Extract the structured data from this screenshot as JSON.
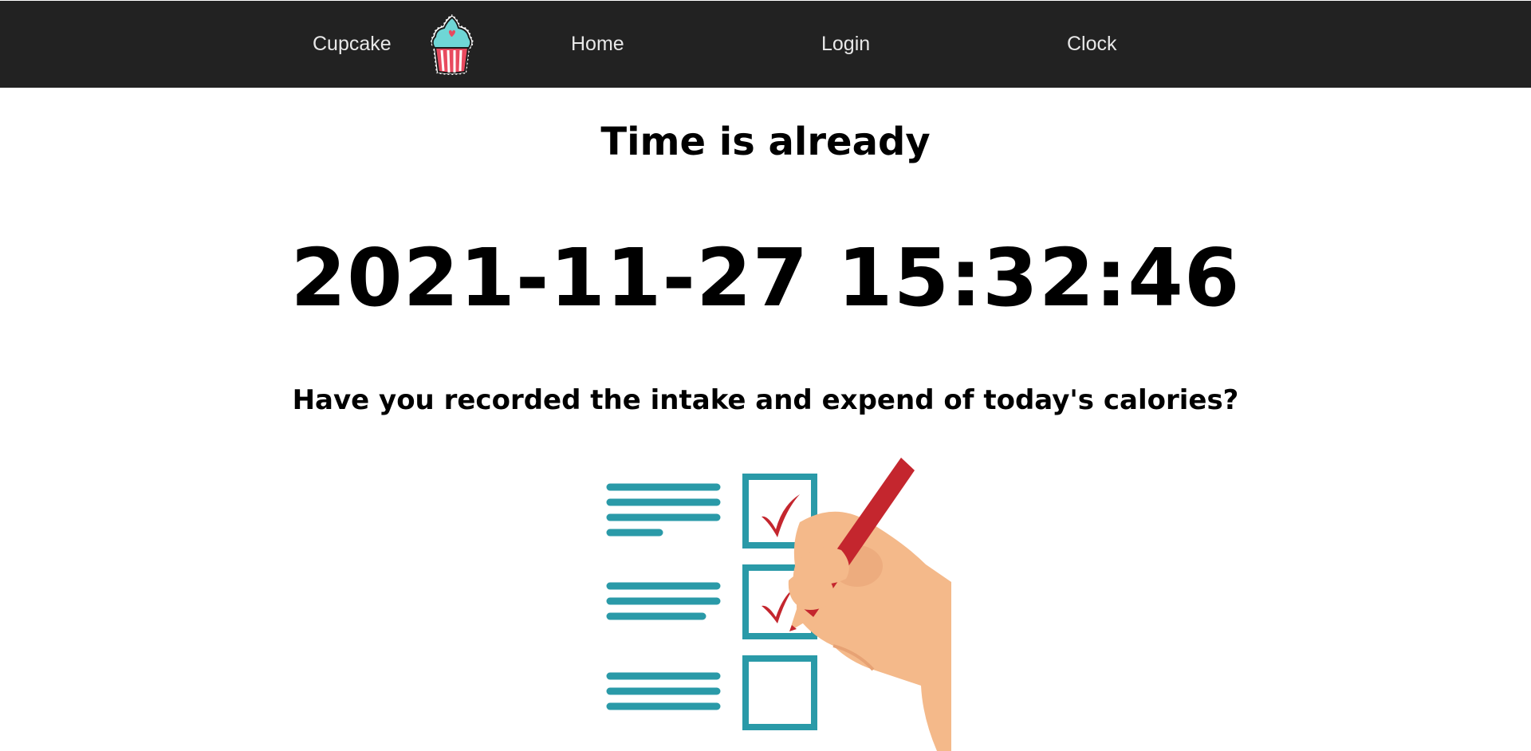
{
  "nav": {
    "brand_label": "Cupcake",
    "brand_logo_icon": "cupcake-icon",
    "items": [
      {
        "label": "Home"
      },
      {
        "label": "Login"
      },
      {
        "label": "Clock"
      }
    ]
  },
  "main": {
    "title": "Time is already",
    "current_datetime": "2021-11-27 15:32:46",
    "question": "Have you recorded the intake and expend of today's calories?",
    "illustration_icon": "checklist-hand-pencil-illustration"
  },
  "colors": {
    "navbar_bg": "#222222",
    "nav_text": "#e8e8e8",
    "checklist_teal": "#2a9aa8",
    "pencil_red": "#c4262e",
    "hand_skin": "#f4b98a",
    "cupcake_frosting": "#6fd6d6",
    "cupcake_wrapper": "#e84a5f"
  }
}
